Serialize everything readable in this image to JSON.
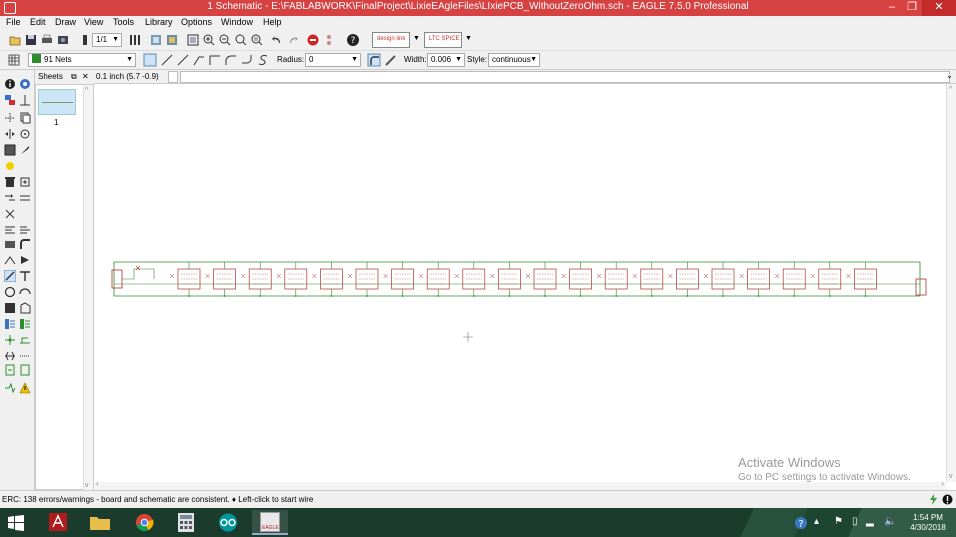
{
  "window": {
    "title": "1 Schematic - E:\\FABLABWORK\\FinalProject\\LixieEAgleFiles\\LIxiePCB_WithoutZeroOhm.sch - EAGLE 7.5.0 Professional",
    "minimize": "–",
    "maximize": "❐",
    "close": "✕"
  },
  "menu": [
    "File",
    "Edit",
    "Draw",
    "View",
    "Tools",
    "Library",
    "Options",
    "Window",
    "Help"
  ],
  "toolbar": {
    "sheet_selector": "1/1",
    "design_link_label": "design link",
    "ltspice_label": "LTC SPICE"
  },
  "params": {
    "layer_value": "91 Nets",
    "radius_label": "Radius:",
    "radius_value": "0",
    "width_label": "Width:",
    "width_value": "0.006",
    "style_label": "Style:",
    "style_value": "continuous"
  },
  "sheets": {
    "title": "Sheets",
    "items": [
      {
        "number": "1"
      }
    ]
  },
  "coords": {
    "readout": "0.1 inch (5.7 -0.9)",
    "command": ""
  },
  "status": {
    "message": "ERC: 138 errors/warnings - board and schematic are consistent.  ♦ Left-click to start wire"
  },
  "watermark": {
    "line1": "Activate Windows",
    "line2": "Go to PC settings to activate Windows."
  },
  "taskbar": {
    "time": "1:54 PM",
    "date": "4/30/2018",
    "eagle_label": "EAGLE"
  },
  "colors": {
    "titlebar": "#d64242",
    "net": "#2e8b2e",
    "part": "#b03030",
    "taskbar": "#1b3b2d"
  }
}
